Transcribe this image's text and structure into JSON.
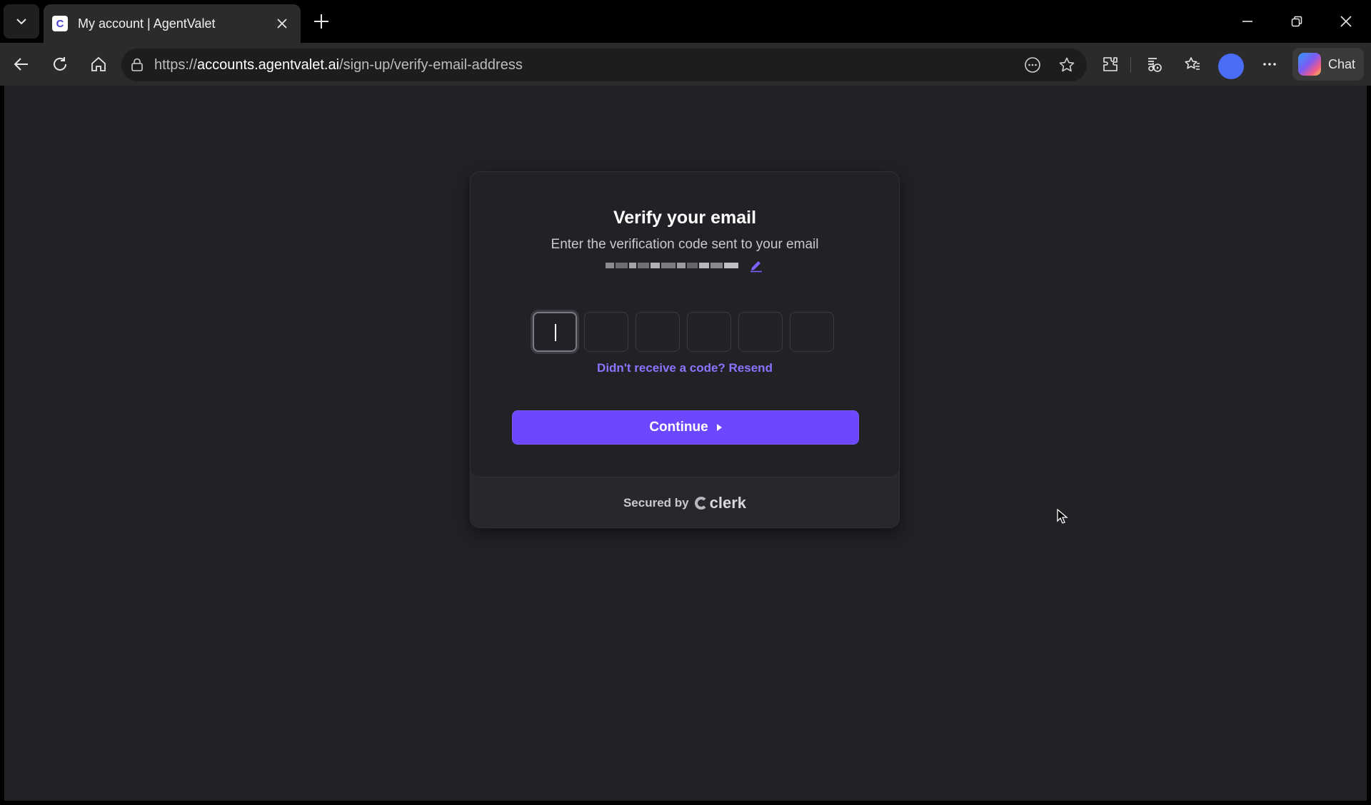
{
  "browser": {
    "tab_title": "My account | AgentValet",
    "favicon_letter": "C",
    "url_scheme": "https://",
    "url_host": "accounts.agentvalet.ai",
    "url_path": "/sign-up/verify-email-address",
    "chat_label": "Chat",
    "icons": [
      "tab-list-icon",
      "close-icon",
      "plus-icon",
      "minimize-icon",
      "restore-icon",
      "window-close-icon",
      "back-icon",
      "refresh-icon",
      "home-icon",
      "lock-icon",
      "reader-icon",
      "star-icon",
      "extensions-icon",
      "media-icon",
      "favorites-icon",
      "more-icon",
      "copilot-icon"
    ]
  },
  "verify": {
    "title": "Verify your email",
    "subtitle": "Enter the verification code sent to your email",
    "email_redacted": true,
    "otp_length": 6,
    "resend_label": "Didn't receive a code? Resend",
    "continue_label": "Continue",
    "secured_by": "Secured by",
    "brand": "clerk"
  },
  "colors": {
    "accent": "#6c47ff",
    "link": "#8b74ff",
    "background": "#212126"
  }
}
